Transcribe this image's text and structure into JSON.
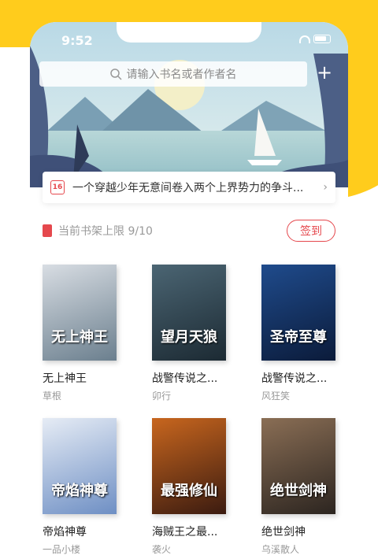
{
  "status_bar": {
    "time": "9:52"
  },
  "search": {
    "placeholder": "请输入书名或者作者名"
  },
  "notice": {
    "date_day": "16",
    "text": "一个穿越少年无意间卷入两个上界势力的争斗..."
  },
  "shelf": {
    "limit_text": "当前书架上限 9/10",
    "signin_label": "签到"
  },
  "books": [
    {
      "title": "无上神王",
      "author": "草根",
      "cover_text": "无上神王",
      "colors": [
        "#6b7f8e",
        "#d8dde3"
      ]
    },
    {
      "title": "战警传说之...",
      "author": "卯行",
      "cover_text": "望月天狼",
      "colors": [
        "#1c2a33",
        "#4b6573"
      ]
    },
    {
      "title": "战警传说之...",
      "author": "风狂笑",
      "cover_text": "圣帝至尊",
      "colors": [
        "#0b1b3a",
        "#1f4b8c"
      ]
    },
    {
      "title": "帝焰神尊",
      "author": "一品小楼",
      "cover_text": "帝焰神尊",
      "colors": [
        "#6e8fc4",
        "#e6ecf5"
      ]
    },
    {
      "title": "海贼王之最...",
      "author": "袭火",
      "cover_text": "最强修仙",
      "colors": [
        "#3b1b10",
        "#c8661e"
      ]
    },
    {
      "title": "绝世剑神",
      "author": "乌溪散人",
      "cover_text": "绝世剑神",
      "colors": [
        "#2c2520",
        "#8a6e55"
      ]
    }
  ]
}
